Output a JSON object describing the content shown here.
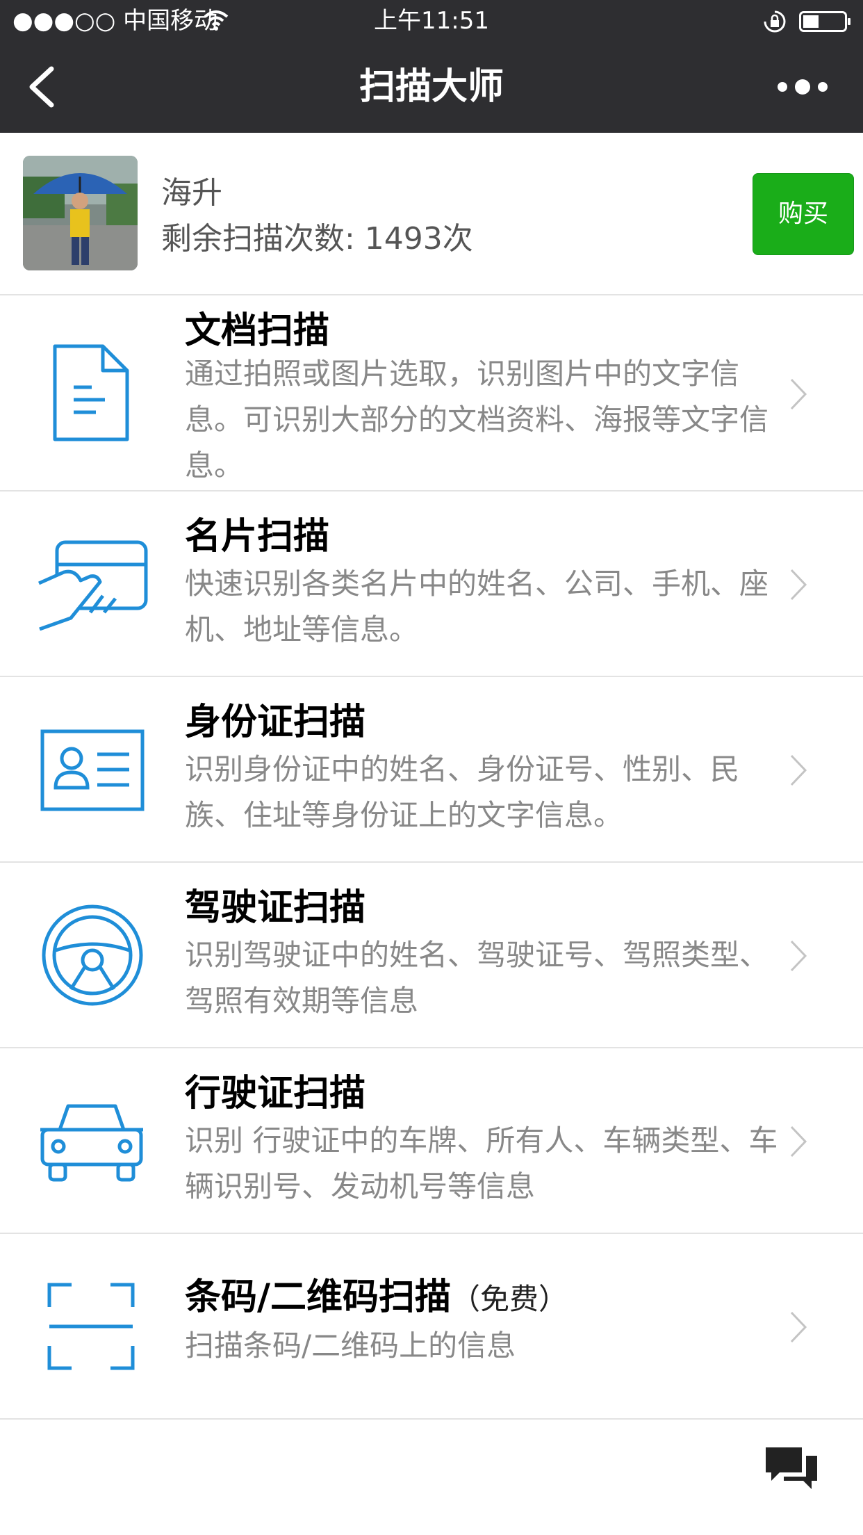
{
  "status_bar": {
    "carrier": "●●●○○ 中国移动",
    "time": "上午11:51"
  },
  "nav": {
    "title": "扫描大师"
  },
  "profile": {
    "name": "海升",
    "remaining": "剩余扫描次数: 1493次",
    "buy_label": "购买"
  },
  "items": [
    {
      "title": "文档扫描",
      "desc": "通过拍照或图片选取，识别图片中的文字信息。可识别大部分的文档资料、海报等文字信息。",
      "icon": "document-icon"
    },
    {
      "title": "名片扫描",
      "desc": "快速识别各类名片中的姓名、公司、手机、座机、地址等信息。",
      "icon": "business-card-icon"
    },
    {
      "title": "身份证扫描",
      "desc": "识别身份证中的姓名、身份证号、性别、民族、住址等身份证上的文字信息。",
      "icon": "id-card-icon"
    },
    {
      "title": "驾驶证扫描",
      "desc": "识别驾驶证中的姓名、驾驶证号、驾照类型、驾照有效期等信息",
      "icon": "steering-wheel-icon"
    },
    {
      "title": "行驶证扫描",
      "desc": "识别 行驶证中的车牌、所有人、车辆类型、车辆识别号、发动机号等信息",
      "icon": "car-icon"
    },
    {
      "title": "条码/二维码扫描",
      "title_suffix": "（免费）",
      "desc": "扫描条码/二维码上的信息",
      "icon": "scan-frame-icon"
    }
  ],
  "colors": {
    "bar_bg": "#2e2e31",
    "accent_blue": "#1f8ed8",
    "buy_green": "#1aad19"
  }
}
